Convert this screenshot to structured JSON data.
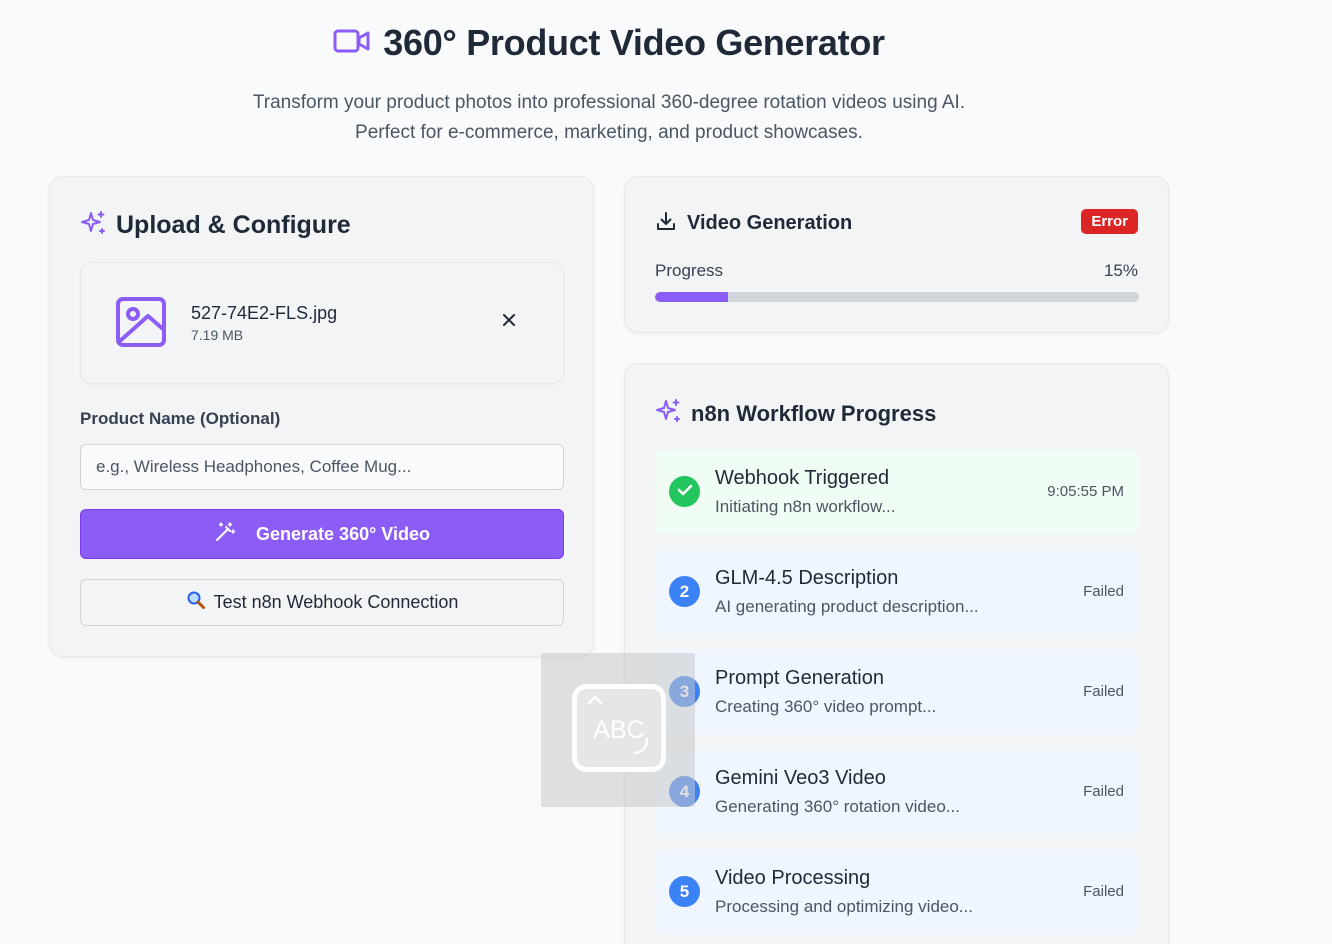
{
  "header": {
    "title": "360° Product Video Generator",
    "subtitle_line1": "Transform your product photos into professional 360-degree rotation videos using AI.",
    "subtitle_line2": "Perfect for e-commerce, marketing, and product showcases.",
    "icon": "video-camera-icon"
  },
  "upload": {
    "title": "Upload & Configure",
    "icon": "sparkles-icon",
    "file": {
      "name": "527-74E2-FLS.jpg",
      "size": "7.19 MB",
      "icon": "image-icon"
    },
    "product_label": "Product Name (Optional)",
    "product_placeholder": "e.g., Wireless Headphones, Coffee Mug...",
    "product_value": "",
    "generate_label": "Generate 360° Video",
    "test_label": "Test n8n Webhook Connection"
  },
  "video": {
    "title": "Video Generation",
    "icon": "download-icon",
    "status_badge": "Error",
    "progress_label": "Progress",
    "progress_text": "15%",
    "progress_fraction": 0.15
  },
  "workflow": {
    "title": "n8n Workflow Progress",
    "icon": "sparkles-icon",
    "steps": [
      {
        "marker": "",
        "title": "Webhook Triggered",
        "desc": "Initiating n8n workflow...",
        "status": "9:05:55 PM",
        "state": "done"
      },
      {
        "marker": "2",
        "title": "GLM-4.5 Description",
        "desc": "AI generating product description...",
        "status": "Failed",
        "state": "failed"
      },
      {
        "marker": "3",
        "title": "Prompt Generation",
        "desc": "Creating 360° video prompt...",
        "status": "Failed",
        "state": "failed"
      },
      {
        "marker": "4",
        "title": "Gemini Veo3 Video",
        "desc": "Generating 360° rotation video...",
        "status": "Failed",
        "state": "failed"
      },
      {
        "marker": "5",
        "title": "Video Processing",
        "desc": "Processing and optimizing video...",
        "status": "Failed",
        "state": "failed"
      }
    ]
  },
  "overlay": {
    "text": "ABC",
    "icon": "keyboard-input-icon"
  },
  "colors": {
    "accent": "#8b5cf6",
    "error": "#dc2626",
    "success": "#22c55e",
    "step_blue": "#3b82f6"
  }
}
